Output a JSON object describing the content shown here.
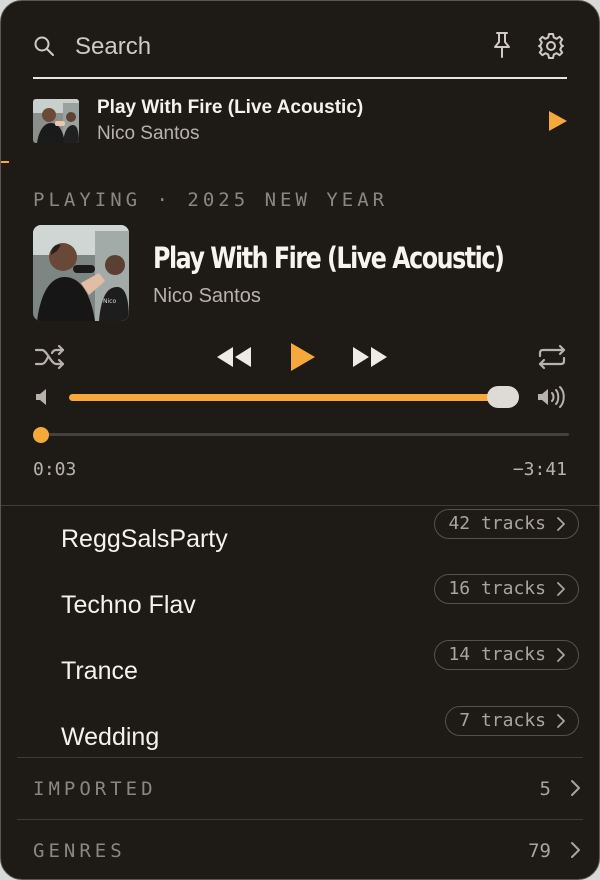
{
  "search": {
    "placeholder": "Search"
  },
  "mini_player": {
    "title": "Play With Fire (Live Acoustic)",
    "artist": "Nico Santos"
  },
  "now_playing": {
    "section_label": "PLAYING · 2025 NEW YEAR",
    "title": "Play With Fire (Live Acoustic)",
    "artist": "Nico Santos",
    "volume_level": 0.96,
    "progress_fraction": 0.014,
    "elapsed": "0:03",
    "remaining": "−3:41"
  },
  "playlists": [
    {
      "name": "ReggSalsParty",
      "count": "42 tracks"
    },
    {
      "name": "Techno Flav",
      "count": "16 tracks"
    },
    {
      "name": "Trance",
      "count": "14 tracks"
    },
    {
      "name": "Wedding",
      "count": "7 tracks"
    }
  ],
  "categories": [
    {
      "label": "IMPORTED",
      "count": "5"
    },
    {
      "label": "GENRES",
      "count": "79"
    }
  ],
  "colors": {
    "accent": "#f6a93a",
    "background": "#1e1b17",
    "text": "#f2efe9"
  }
}
